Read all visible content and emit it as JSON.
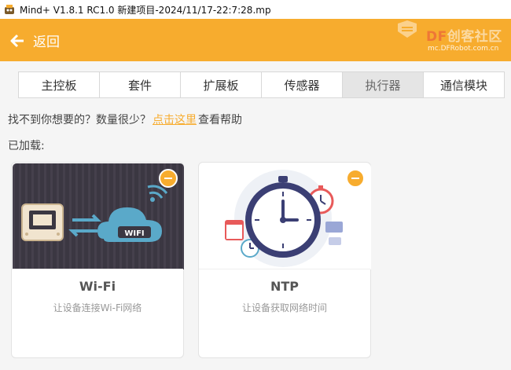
{
  "window": {
    "title": "Mind+ V1.8.1 RC1.0    新建项目-2024/11/17-22:7:28.mp"
  },
  "header": {
    "back_label": "返回",
    "logo_brand_df": "DF",
    "logo_brand_rest": "创客社区",
    "logo_url": "mc.DFRobot.com.cn",
    "color": "#f7ac2e"
  },
  "tabs": [
    {
      "label": "主控板"
    },
    {
      "label": "套件"
    },
    {
      "label": "扩展板"
    },
    {
      "label": "传感器"
    },
    {
      "label": "执行器",
      "active": true
    },
    {
      "label": "通信模块"
    }
  ],
  "help": {
    "prefix": "找不到你想要的？数量很少？",
    "link": "点击这里",
    "suffix": "查看帮助"
  },
  "loaded_label": "已加载:",
  "cards": [
    {
      "name": "Wi-Fi",
      "desc": "让设备连接Wi-Fi网络",
      "image_text": "WIFI",
      "icon": "wifi-cloud-icon"
    },
    {
      "name": "NTP",
      "desc": "让设备获取网络时间",
      "icon": "clock-icon"
    }
  ]
}
